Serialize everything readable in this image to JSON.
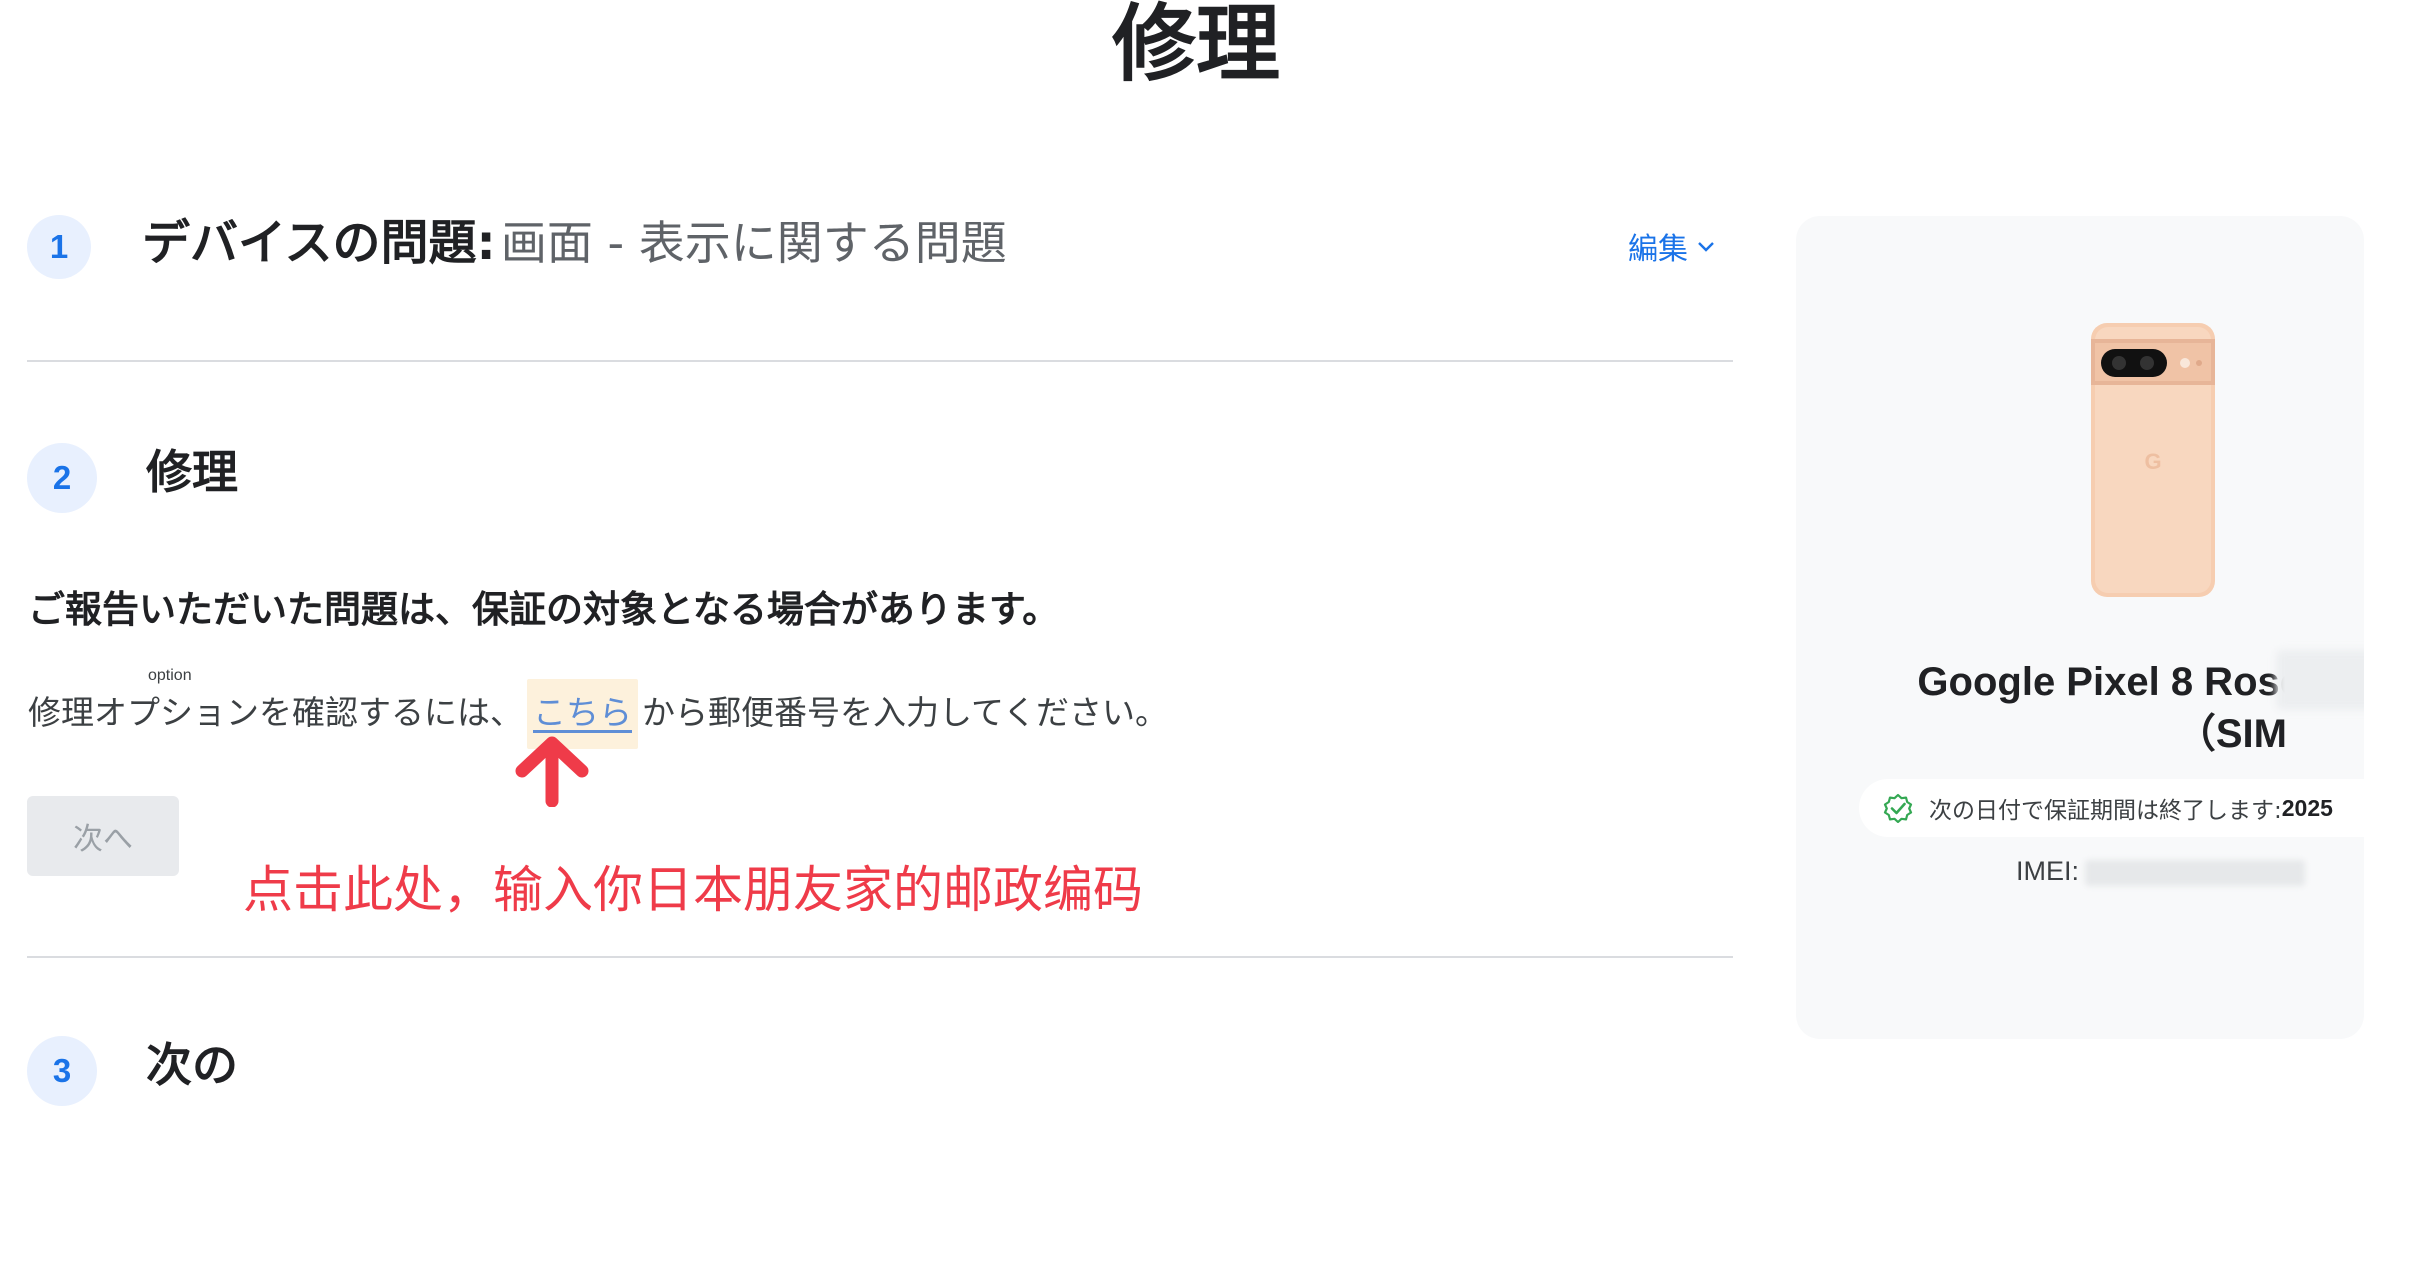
{
  "page": {
    "title": "修理"
  },
  "step1": {
    "number": "1",
    "label": "デバイスの問題:",
    "value": "画面 - 表示に関する問題",
    "edit_label": "編集"
  },
  "step2": {
    "number": "2",
    "heading": "修理",
    "warranty_note": "ご報告いただいた問題は、保証の対象となる場合があります。",
    "zip_prefix": "修理オプションを確認するには、",
    "zip_link": "こちら",
    "zip_suffix": "から郵便番号を入力してください。",
    "ruby_note": "option",
    "next_label": "次へ"
  },
  "step3": {
    "number": "3",
    "heading": "次の"
  },
  "annotation": {
    "text": "点击此处，输入你日本朋友家的邮政编码",
    "color": "#ef3b49"
  },
  "device": {
    "name_line1": "Google Pixel 8 Rose",
    "name_line2": "（SIM",
    "warranty_text": "次の日付で保証期間は終了します: ",
    "warranty_date": "2025",
    "imei_label": "IMEI:"
  },
  "colors": {
    "accent": "#1a73e8",
    "step_bg": "#e8f0fe",
    "check": "#34a853",
    "phone": "#f8d3b8"
  }
}
